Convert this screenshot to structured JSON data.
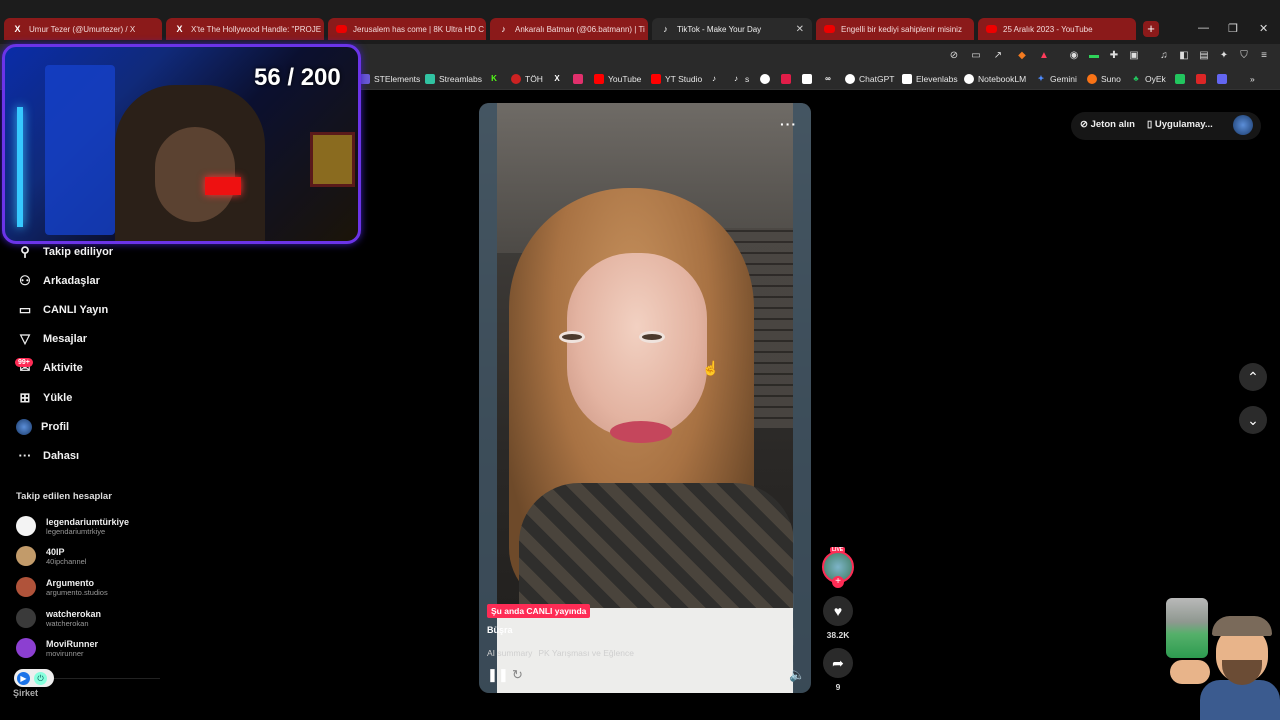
{
  "browser": {
    "tabs": [
      {
        "title": "Umur Tezer (@Umurtezer) / X",
        "icon": "x-icon"
      },
      {
        "title": "X'te The Hollywood Handle: \"PROJE",
        "icon": "x-icon"
      },
      {
        "title": "Jerusalem has come | 8K Ultra HD C",
        "icon": "youtube-icon"
      },
      {
        "title": "Ankaralı Batman (@06.batmann) | Ti",
        "icon": "tiktok-icon"
      },
      {
        "title": "TikTok - Make Your Day",
        "icon": "tiktok-icon",
        "active": true
      },
      {
        "title": "Engelli bir kediyi sahiplenir misiniz",
        "icon": "youtube-icon"
      },
      {
        "title": "25 Aralık 2023 - YouTube",
        "icon": "youtube-icon"
      }
    ],
    "new_tab": "+",
    "tab_close": "✕",
    "window_controls": {
      "minimize": "—",
      "maximize": "❐",
      "close": "✕"
    },
    "bookmarks": [
      {
        "label": "STElements",
        "color": "#6b5bd6"
      },
      {
        "label": "Streamlabs",
        "color": "#31c3a2"
      },
      {
        "label": "",
        "color": "#53fc18",
        "glyph": "K"
      },
      {
        "label": "TÖH",
        "color": "#cc2222"
      },
      {
        "label": "",
        "color": "#ffffff",
        "glyph": "X"
      },
      {
        "label": "",
        "color": "#e1306c"
      },
      {
        "label": "YouTube",
        "color": "#ff0000"
      },
      {
        "label": "YT Studio",
        "color": "#ff0000"
      },
      {
        "label": "",
        "color": "#ffffff",
        "glyph": "♪"
      },
      {
        "label": "s",
        "color": "#ffffff",
        "glyph": "♪"
      },
      {
        "label": "ChatGPT",
        "color": "#ffffff"
      },
      {
        "label": "Elevenlabs",
        "color": "#ffffff"
      },
      {
        "label": "NotebookLM",
        "color": "#ffffff"
      },
      {
        "label": "Gemini",
        "color": "#4e8cff"
      },
      {
        "label": "Suno",
        "color": "#f97316"
      },
      {
        "label": "OyEk",
        "color": "#22c55e"
      }
    ]
  },
  "overlay": {
    "counter": "56 / 200"
  },
  "sidebar": {
    "nav": [
      {
        "label": "Takip ediliyor",
        "icon": "following-icon",
        "glyph": "👤"
      },
      {
        "label": "Arkadaşlar",
        "icon": "friends-icon",
        "glyph": "👥"
      },
      {
        "label": "CANLI Yayın",
        "icon": "live-icon",
        "glyph": "▭"
      },
      {
        "label": "Mesajlar",
        "icon": "messages-icon",
        "glyph": "▽"
      },
      {
        "label": "Aktivite",
        "icon": "activity-icon",
        "glyph": "✉"
      },
      {
        "label": "Yükle",
        "icon": "upload-icon",
        "glyph": "⊞"
      },
      {
        "label": "Profil",
        "icon": "profile-icon",
        "glyph": "●"
      },
      {
        "label": "Dahası",
        "icon": "more-icon",
        "glyph": "···"
      }
    ],
    "activity_badge": "99+",
    "following_title": "Takip edilen hesaplar",
    "accounts": [
      {
        "name": "legendariumtürkiye",
        "handle": "legendariumtrkiye",
        "color": "#f3f3f3"
      },
      {
        "name": "40IP",
        "handle": "40ipchannel",
        "color": "#c29b6a"
      },
      {
        "name": "Argumento",
        "handle": "argumento.studios",
        "color": "#b0533a"
      },
      {
        "name": "watcherokan",
        "handle": "watcherokan",
        "color": "#3a3a3a"
      },
      {
        "name": "MoviRunner",
        "handle": "movirunner",
        "color": "#8c3fd1"
      }
    ],
    "company": "Şirket"
  },
  "video": {
    "live_tag": "Şu anda CANLI yayında",
    "author": "Büşra",
    "summary_label": "AI summary",
    "summary_text": "PK Yarışması ve Eğlence",
    "more": "···",
    "likes": "38.2K",
    "shares": "9",
    "live_badge": "LIVE"
  },
  "topbar": {
    "coins": "Jeton alın",
    "app": "Uygulamay..."
  }
}
